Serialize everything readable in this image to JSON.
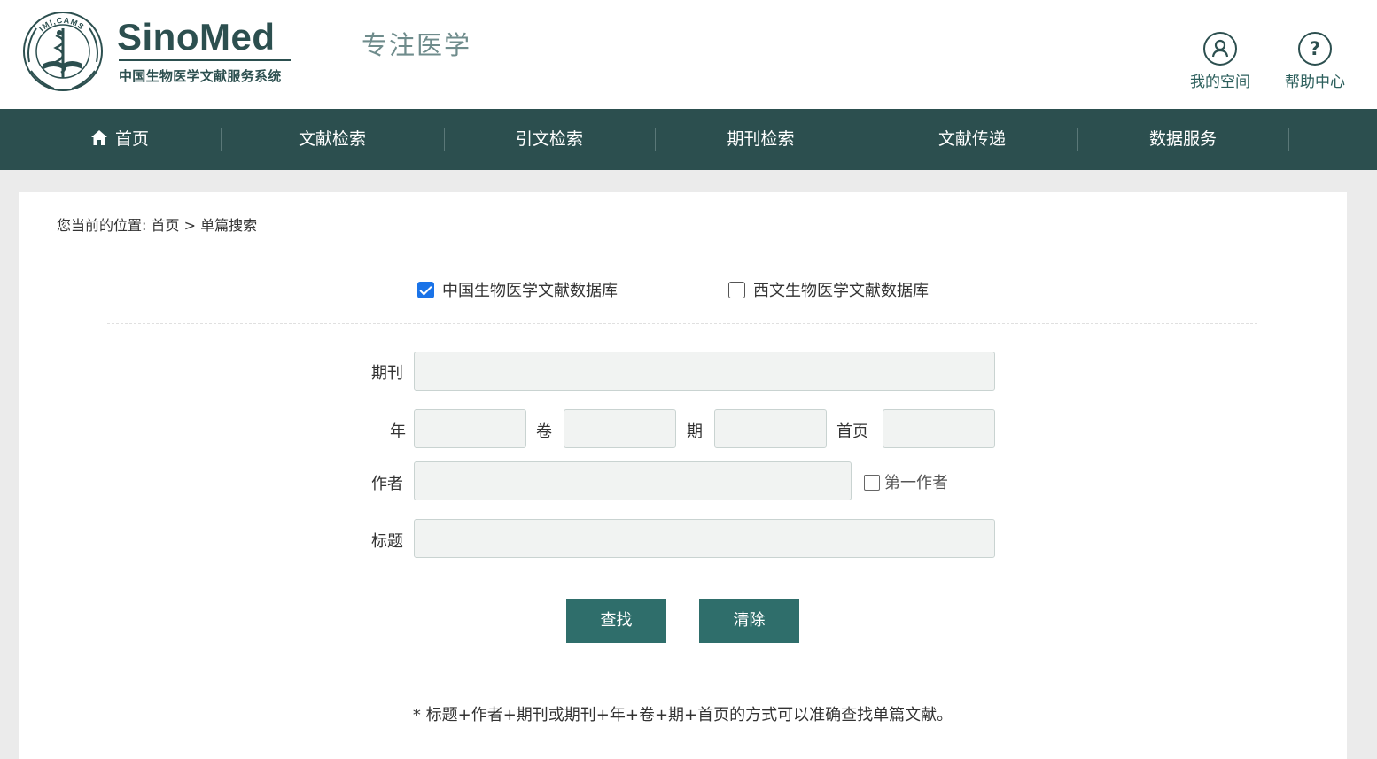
{
  "header": {
    "logo_ring_text": "IMI,CAMS",
    "logo_title": "SinoMed",
    "logo_subtitle": "中国生物医学文献服务系统",
    "slogan": "专注医学",
    "links": [
      {
        "label": "我的空间",
        "icon": "user-icon"
      },
      {
        "label": "帮助中心",
        "icon": "help-icon"
      }
    ]
  },
  "nav": {
    "items": [
      {
        "label": "首页",
        "icon": "home-icon"
      },
      {
        "label": "文献检索"
      },
      {
        "label": "引文检索"
      },
      {
        "label": "期刊检索"
      },
      {
        "label": "文献传递"
      },
      {
        "label": "数据服务"
      }
    ]
  },
  "breadcrumb": {
    "prefix": "您当前的位置:",
    "path": "首页 > 单篇搜索"
  },
  "databases": [
    {
      "label": "中国生物医学文献数据库",
      "checked": true
    },
    {
      "label": "西文生物医学文献数据库",
      "checked": false
    }
  ],
  "form": {
    "journal_label": "期刊",
    "journal_value": "",
    "year_label": "年",
    "year_value": "",
    "volume_label": "卷",
    "volume_value": "",
    "issue_label": "期",
    "issue_value": "",
    "first_page_label": "首页",
    "first_page_value": "",
    "author_label": "作者",
    "author_value": "",
    "first_author_label": "第一作者",
    "first_author_checked": false,
    "title_label": "标题",
    "title_value": ""
  },
  "buttons": {
    "search": "查找",
    "clear": "清除"
  },
  "note": "* 标题+作者+期刊或期刊+年+卷+期+首页的方式可以准确查找单篇文献。",
  "colors": {
    "brand": "#2c4f4f",
    "button": "#2f6e6b",
    "checkbox_checked": "#1a73e8"
  }
}
